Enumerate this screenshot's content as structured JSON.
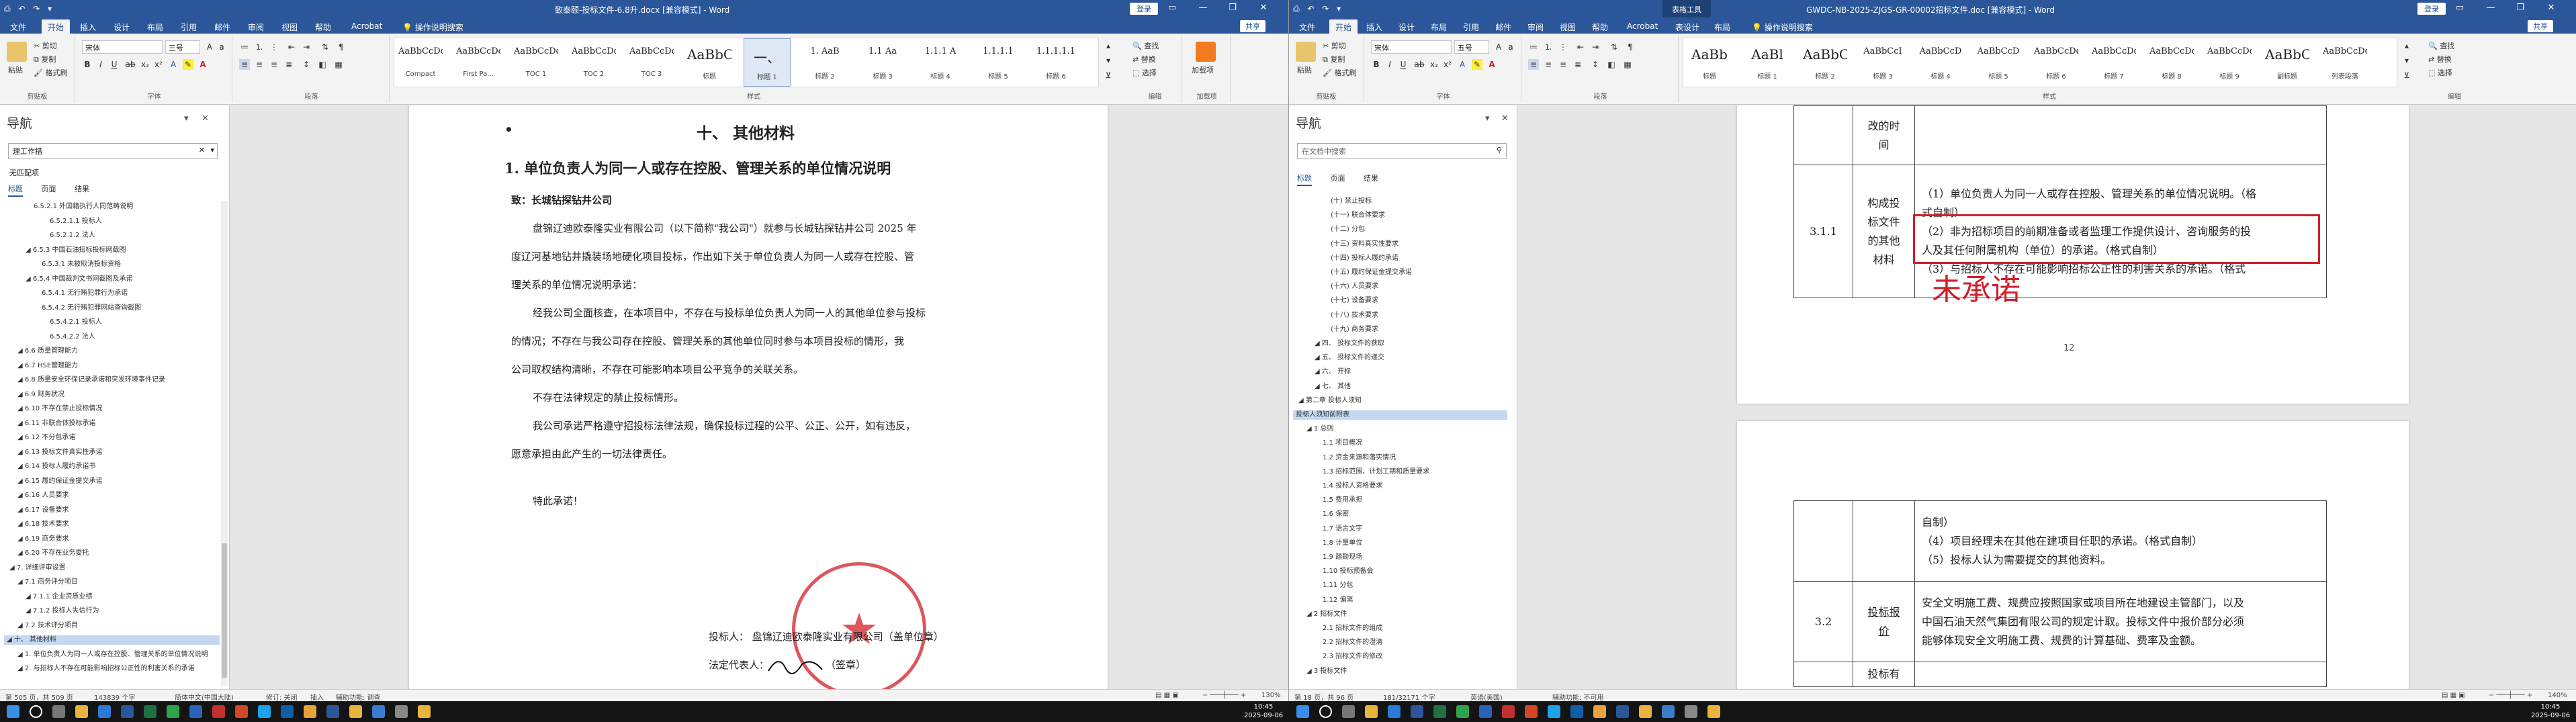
{
  "left": {
    "title": "致泰颐-投标文件-6.8升.docx [兼容模式] - Word",
    "signin": "登录",
    "share": "共享",
    "tabs": [
      "文件",
      "开始",
      "插入",
      "设计",
      "布局",
      "引用",
      "邮件",
      "审阅",
      "视图",
      "帮助",
      "Acrobat",
      "操作说明搜索"
    ],
    "ribbon": {
      "clipboard": {
        "paste": "粘贴",
        "cut": "剪切",
        "copy": "复制",
        "painter": "格式刷",
        "label": "剪贴板"
      },
      "font": {
        "name": "宋体",
        "size": "三号",
        "label": "字体"
      },
      "paragraph": {
        "label": "段落"
      },
      "styles": [
        {
          "preview": "AaBbCcDd",
          "name": "Compact"
        },
        {
          "preview": "AaBbCcDd",
          "name": "First Pa..."
        },
        {
          "preview": "AaBbCcDd",
          "name": "TOC 1"
        },
        {
          "preview": "AaBbCcDd",
          "name": "TOC 2"
        },
        {
          "preview": "AaBbCcDd",
          "name": "TOC 3"
        },
        {
          "preview": "AaBbC",
          "name": "标题"
        },
        {
          "preview": "一、",
          "name": "标题 1"
        },
        {
          "preview": "1. AaB",
          "name": "标题 2"
        },
        {
          "preview": "1.1 Aa",
          "name": "标题 3"
        },
        {
          "preview": "1.1.1 A",
          "name": "标题 4"
        },
        {
          "preview": "1.1.1.1",
          "name": "标题 5"
        },
        {
          "preview": "1.1.1.1.1",
          "name": "标题 6"
        }
      ],
      "styles_label": "样式",
      "editing": {
        "find": "查找",
        "replace": "替换",
        "select": "选择",
        "label": "编辑"
      },
      "addin": {
        "name": "加载项",
        "label": "加载项"
      }
    },
    "nav": {
      "title": "导航",
      "search": "理工作措",
      "no_match": "无匹配项",
      "tabs": [
        "标题",
        "页面",
        "结果"
      ],
      "items": [
        {
          "t": "6.5.2.1 外国籍执行人同范畴说明",
          "i": 3
        },
        {
          "t": "6.5.2.1.1 投标人",
          "i": 5
        },
        {
          "t": "6.5.2.1.2 法人",
          "i": 5
        },
        {
          "t": "6.5.3 中国石油招标投标网截图",
          "i": 2
        },
        {
          "t": "6.5.3.1 未被取消投标资格",
          "i": 4
        },
        {
          "t": "6.5.4 中国裁判文书网截图及承诺",
          "i": 2
        },
        {
          "t": "6.5.4.1 无行贿犯罪行为承诺",
          "i": 4
        },
        {
          "t": "6.5.4.2 无行贿犯罪网站查询截图",
          "i": 4
        },
        {
          "t": "6.5.4.2.1 投标人",
          "i": 5
        },
        {
          "t": "6.5.4.2.2 法人",
          "i": 5
        },
        {
          "t": "6.6 质量管理能力",
          "i": 1
        },
        {
          "t": "6.7 HSE管理能力",
          "i": 1
        },
        {
          "t": "6.8 质量安全环保记录承诺和突发环境事件记录",
          "i": 1
        },
        {
          "t": "6.9 财务状况",
          "i": 1
        },
        {
          "t": "6.10 不存在禁止投标情况",
          "i": 1
        },
        {
          "t": "6.11 非联合体投标承诺",
          "i": 1
        },
        {
          "t": "6.12 不分包承诺",
          "i": 1
        },
        {
          "t": "6.13 投标文件真实性承诺",
          "i": 1
        },
        {
          "t": "6.14 投标人履约承诺书",
          "i": 1
        },
        {
          "t": "6.15 履约保证金提交承诺",
          "i": 1
        },
        {
          "t": "6.16 人员要求",
          "i": 1
        },
        {
          "t": "6.17 设备要求",
          "i": 1
        },
        {
          "t": "6.18 技术要求",
          "i": 1
        },
        {
          "t": "6.19 商务要求",
          "i": 1
        },
        {
          "t": "6.20 不存在业务委托",
          "i": 1
        },
        {
          "t": "7. 详细评审设置",
          "i": 0
        },
        {
          "t": "7.1 商务评分项目",
          "i": 1
        },
        {
          "t": "7.1.1 企业资质业绩",
          "i": 2
        },
        {
          "t": "7.1.2 投标人失信行为",
          "i": 2
        },
        {
          "t": "7.2 技术评分项目",
          "i": 1
        },
        {
          "t": "十、 其他材料",
          "i": 0,
          "sel": true
        },
        {
          "t": "1. 单位负责人为同一人或存在控股、管理关系的单位情况说明",
          "i": 1
        },
        {
          "t": "2. 与招标人不存在可能影响招标公正性的利害关系的承诺",
          "i": 1
        }
      ]
    },
    "doc": {
      "bullet": "•",
      "heading": "十、  其他材料",
      "sub": "1.  单位负责人为同一人或存在控股、管理关系的单位情况说明",
      "to": "致：长城钻探钻井公司",
      "para1a": "盘锦辽迪欧泰隆实业有限公司（以下简称\"我公司\"）就参与长城钻探钻井公司 2025 年",
      "para1b": "度辽河基地钻井撬装场地硬化项目投标，作出如下关于单位负责人为同一人或存在控股、管",
      "para1c": "理关系的单位情况说明承诺：",
      "para2a": "经我公司全面核查，在本项目中，不存在与投标单位负责人为同一人的其他单位参与投标",
      "para2b": "的情况；不存在与我公司存在控股、管理关系的其他单位同时参与本项目投标的情形，我",
      "para2c": "公司取权结构清晰，不存在可能影响本项目公平竞争的关联关系。",
      "para3": "不存在法律规定的禁止投标情形。",
      "para4a": "我公司承诺严格遵守招投标法律法规，确保投标过程的公平、公正、公开，如有违反，",
      "para4b": "愿意承担由此产生的一切法律责任。",
      "special": "特此承诺！",
      "sig1": "投标人：  盘锦辽迪欧泰隆实业有限公司（盖单位章）",
      "sig2": "法定代表人：",
      "sig2b": "（签章）",
      "stamp_text": "盘锦辽迪欧泰隆实业有限公司"
    },
    "status": {
      "page": "第 505 页，共 509 页",
      "words": "143839 个字",
      "lang": "简体中文(中国大陆)",
      "track": "修订: 关闭",
      "insert": "插入",
      "acc": "辅助功能: 调查",
      "zoom": "130%"
    }
  },
  "right": {
    "title": "GWDC-NB-2025-ZJGS-GR-00002招标文件.doc [兼容模式] - Word",
    "ctx_tool": "表格工具",
    "signin": "登录",
    "share": "共享",
    "tabs": [
      "文件",
      "开始",
      "插入",
      "设计",
      "布局",
      "引用",
      "邮件",
      "审阅",
      "视图",
      "帮助",
      "Acrobat",
      "表设计",
      "布局",
      "操作说明搜索"
    ],
    "ribbon": {
      "clipboard": {
        "paste": "粘贴",
        "cut": "剪切",
        "copy": "复制",
        "painter": "格式刷",
        "label": "剪贴板"
      },
      "font": {
        "name": "宋体",
        "size": "五号",
        "label": "字体"
      },
      "paragraph": {
        "label": "段落"
      },
      "styles": [
        {
          "preview": "AaBb",
          "name": "标题"
        },
        {
          "preview": "AaBl",
          "name": "标题 1"
        },
        {
          "preview": "AaBbC",
          "name": "标题 2"
        },
        {
          "preview": "AaBbCcI",
          "name": "标题 3"
        },
        {
          "preview": "AaBbCcD",
          "name": "标题 4"
        },
        {
          "preview": "AaBbCcD",
          "name": "标题 5"
        },
        {
          "preview": "AaBbCcDd",
          "name": "标题 6"
        },
        {
          "preview": "AaBbCcDd",
          "name": "标题 7"
        },
        {
          "preview": "AaBbCcDd",
          "name": "标题 8"
        },
        {
          "preview": "AaBbCcDd",
          "name": "标题 9"
        },
        {
          "preview": "AaBbC",
          "name": "副标题"
        },
        {
          "preview": "AaBbCcDd",
          "name": "列表段落"
        }
      ],
      "styles_label": "样式",
      "editing": {
        "find": "查找",
        "replace": "替换",
        "select": "选择",
        "label": "编辑"
      }
    },
    "nav": {
      "title": "导航",
      "search": "在文档中搜索",
      "tabs": [
        "标题",
        "页面",
        "结果"
      ],
      "items": [
        {
          "t": "(十) 禁止投标",
          "i": 4
        },
        {
          "t": "(十一) 联合体要求",
          "i": 4
        },
        {
          "t": "(十二) 分包",
          "i": 4
        },
        {
          "t": "(十三) 资料真实性要求",
          "i": 4
        },
        {
          "t": "(十四) 投标人履约承诺",
          "i": 4
        },
        {
          "t": "(十五) 履约保证金提交承诺",
          "i": 4
        },
        {
          "t": "(十六) 人员要求",
          "i": 4
        },
        {
          "t": "(十七) 设备要求",
          "i": 4
        },
        {
          "t": "(十八) 技术要求",
          "i": 4
        },
        {
          "t": "(十九) 商务要求",
          "i": 4
        },
        {
          "t": "四、 投标文件的获取",
          "i": 2
        },
        {
          "t": "五、 投标文件的递交",
          "i": 2
        },
        {
          "t": "六、 开标",
          "i": 2
        },
        {
          "t": "七、 其他",
          "i": 2
        },
        {
          "t": "第二章 投标人须知",
          "i": 0
        },
        {
          "t": "投标人须知前附表",
          "i": 3,
          "sel": true
        },
        {
          "t": "1 总则",
          "i": 1
        },
        {
          "t": "1.1 项目概况",
          "i": 3
        },
        {
          "t": "1.2 资金来源和落实情况",
          "i": 3
        },
        {
          "t": "1.3 招标范围、计划工期和质量要求",
          "i": 3
        },
        {
          "t": "1.4 投标人资格要求",
          "i": 3
        },
        {
          "t": "1.5 费用承担",
          "i": 3
        },
        {
          "t": "1.6 保密",
          "i": 3
        },
        {
          "t": "1.7 语言文字",
          "i": 3
        },
        {
          "t": "1.8 计量单位",
          "i": 3
        },
        {
          "t": "1.9 踏勘现场",
          "i": 3
        },
        {
          "t": "1.10 投标预备会",
          "i": 3
        },
        {
          "t": "1.11 分包",
          "i": 3
        },
        {
          "t": "1.12 偏离",
          "i": 3
        },
        {
          "t": "2 招标文件",
          "i": 1
        },
        {
          "t": "2.1 招标文件的组成",
          "i": 3
        },
        {
          "t": "2.2 招标文件的澄清",
          "i": 3
        },
        {
          "t": "2.3 招标文件的修改",
          "i": 3
        },
        {
          "t": "3 投标文件",
          "i": 1
        }
      ]
    },
    "doc": {
      "top_col2a": "改的时",
      "top_col2b": "间",
      "row_num": "3.1.1",
      "row_label": [
        "构成投",
        "标文件",
        "的其他",
        "材料"
      ],
      "item1": "（1）单位负责人为同一人或存在控股、管理关系的单位情况说明。（格",
      "item1b": "式自制）",
      "item2": "（2）非为招标项目的前期准备或者监理工作提供设计、咨询服务的投",
      "item2b": "人及其任何附属机构（单位）的承诺。（格式自制）",
      "item3": "（3）与招标人不存在可能影响招标公正性的利害关系的承诺。（格式",
      "annot": "未承诺",
      "page_no": "12",
      "p2_auto": "自制）",
      "p2_item4": "（4）项目经理未在其他在建项目任职的承诺。（格式自制）",
      "p2_item5": "（5）投标人认为需要提交的其他资料。",
      "row2_num": "3.2",
      "row2_label": [
        "投标报",
        "价"
      ],
      "row2_text_a": "安全文明施工费、规费应按照国家或项目所在地建设主管部门，以及",
      "row2_text_b": "中国石油天然气集团有限公司的规定计取。投标文件中报价部分必须",
      "row2_text_c": "能够体现安全文明施工费、规费的计算基础、费率及金额。",
      "row3_label": "投标有"
    },
    "status": {
      "page": "第 18 页，共 96 页",
      "words": "181/32171 个字",
      "lang": "英语(美国)",
      "acc": "辅助功能: 不可用",
      "zoom": "140%"
    }
  },
  "taskbar": {
    "time_left": "10:45",
    "date_left": "2025-09-06",
    "time_right": "10:45",
    "date_right": "2025-09-06"
  },
  "colors": {
    "title": "#2b579a",
    "red_annot": "#d11f2a",
    "highlight": "#c5d8f1"
  }
}
